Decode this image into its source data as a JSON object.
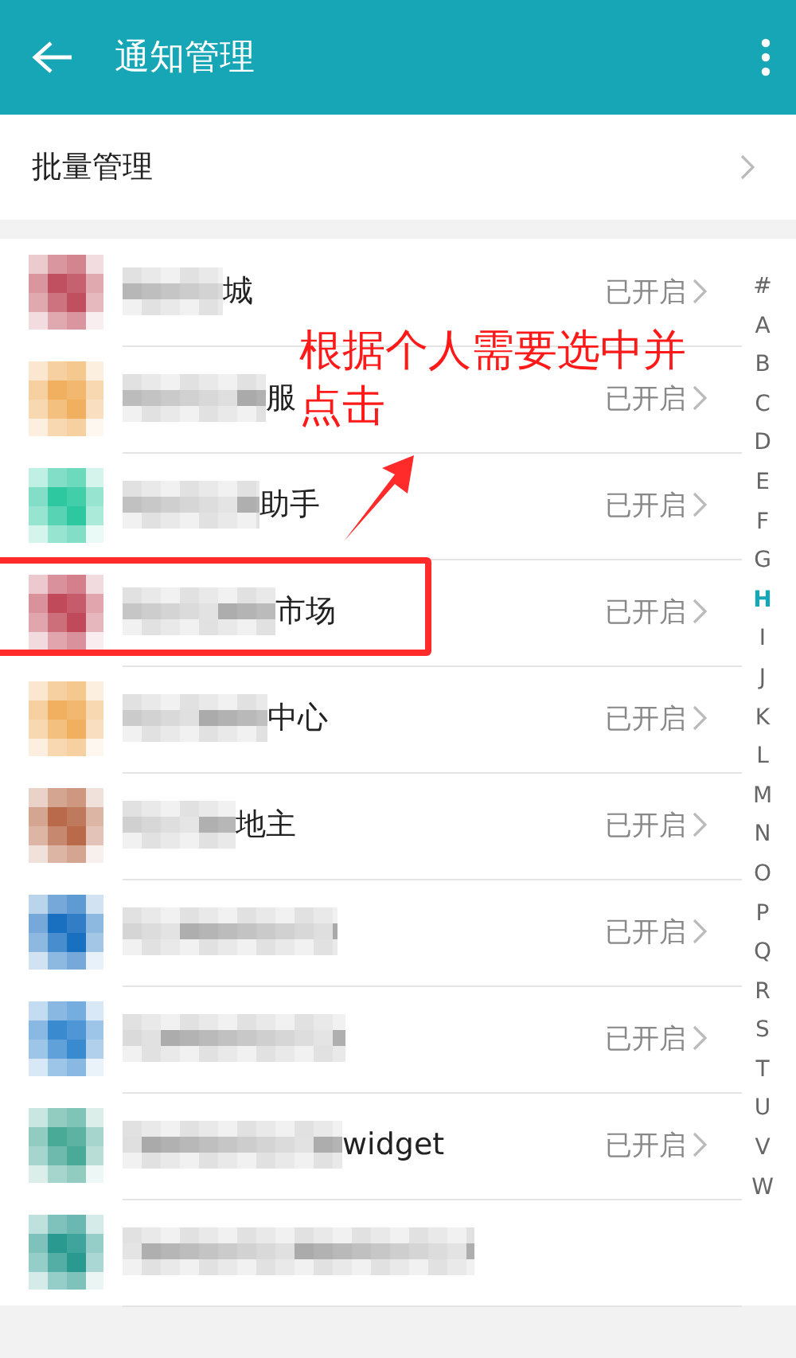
{
  "header": {
    "title": "通知管理"
  },
  "batch_row": {
    "label": "批量管理"
  },
  "apps": [
    {
      "name": "城",
      "status": "已开启",
      "color": "#c0505f",
      "highlighted": false
    },
    {
      "name": "服",
      "status": "已开启",
      "color": "#f0b060",
      "highlighted": false
    },
    {
      "name": "助手",
      "status": "已开启",
      "color": "#2ec8a0",
      "highlighted": false
    },
    {
      "name": "市场",
      "status": "已开启",
      "color": "#c04a5a",
      "highlighted": true
    },
    {
      "name": "中心",
      "status": "已开启",
      "color": "#f0b060",
      "highlighted": false
    },
    {
      "name": "地主",
      "status": "已开启",
      "color": "#b86a4a",
      "highlighted": false
    },
    {
      "status": "已开启",
      "color": "#1a70c0",
      "highlighted": false
    },
    {
      "status": "已开启",
      "color": "#3a8ad0",
      "highlighted": false
    },
    {
      "name": "widget",
      "status": "已开启",
      "color": "#4aaa98",
      "highlighted": false
    },
    {
      "color": "#2a9a90",
      "highlighted": false
    }
  ],
  "index": [
    {
      "letter": "#",
      "selected": false
    },
    {
      "letter": "A",
      "selected": false
    },
    {
      "letter": "B",
      "selected": false
    },
    {
      "letter": "C",
      "selected": false
    },
    {
      "letter": "D",
      "selected": false
    },
    {
      "letter": "E",
      "selected": false
    },
    {
      "letter": "F",
      "selected": false
    },
    {
      "letter": "G",
      "selected": false
    },
    {
      "letter": "H",
      "selected": true
    },
    {
      "letter": "I",
      "selected": false
    },
    {
      "letter": "J",
      "selected": false
    },
    {
      "letter": "K",
      "selected": false
    },
    {
      "letter": "L",
      "selected": false
    },
    {
      "letter": "M",
      "selected": false
    },
    {
      "letter": "N",
      "selected": false
    },
    {
      "letter": "O",
      "selected": false
    },
    {
      "letter": "P",
      "selected": false
    },
    {
      "letter": "Q",
      "selected": false
    },
    {
      "letter": "R",
      "selected": false
    },
    {
      "letter": "S",
      "selected": false
    },
    {
      "letter": "T",
      "selected": false
    },
    {
      "letter": "U",
      "selected": false
    },
    {
      "letter": "V",
      "selected": false
    },
    {
      "letter": "W",
      "selected": false
    }
  ],
  "annotation": {
    "lines": [
      "根据个人需要选中并",
      "点击"
    ]
  }
}
